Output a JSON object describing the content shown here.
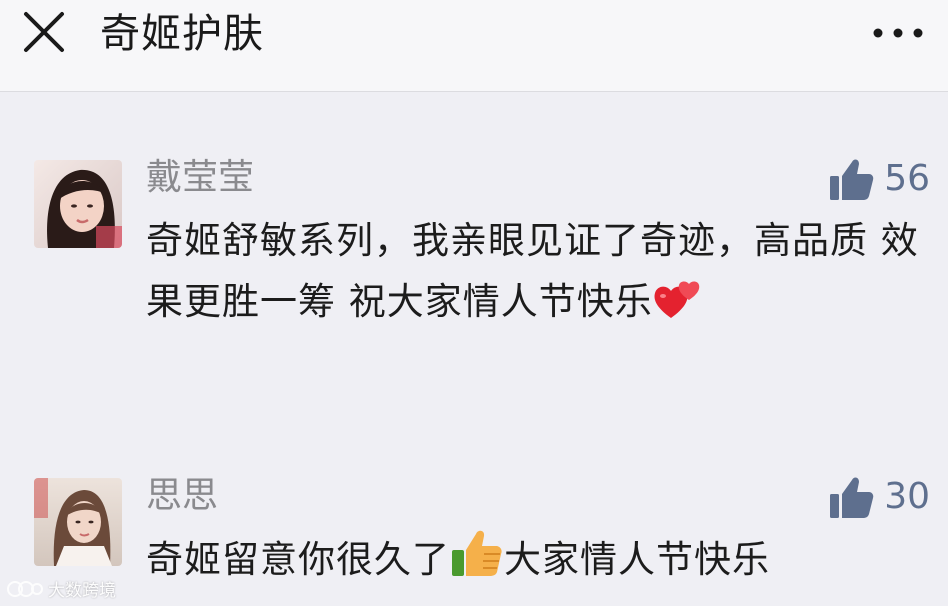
{
  "header": {
    "title": "奇姬护肤",
    "close_icon": "close-icon",
    "more_icon": "more-icon"
  },
  "comments": [
    {
      "author": "戴莹莹",
      "likes": "56",
      "text": "奇姬舒敏系列，我亲眼见证了奇迹，高品质  效果更胜一筹  祝大家情人节快乐",
      "emoji": "two-hearts-icon"
    },
    {
      "author": "思思",
      "likes": "30",
      "text_before": "奇姬留意你很久了",
      "emoji": "thumbs-up-emoji",
      "text_after": "大家情人节快乐"
    }
  ],
  "watermark": {
    "text": "大数跨境"
  },
  "colors": {
    "background": "#efeff4",
    "like_icon": "#5e6f8e"
  }
}
